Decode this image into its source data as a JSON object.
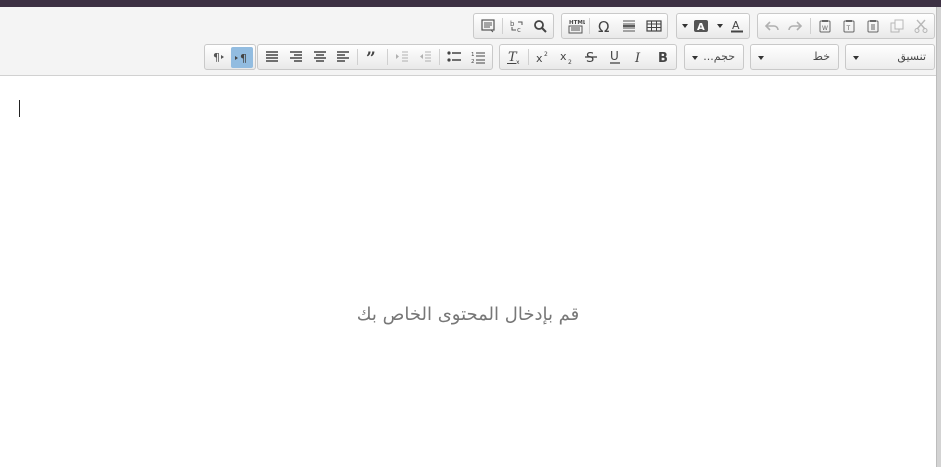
{
  "toolbar": {
    "styles_combo": "تنسيق",
    "font_combo": "خط",
    "size_combo": "حجم..."
  },
  "editor": {
    "placeholder": "قم بإدخال المحتوى الخاص بك"
  },
  "colors": {
    "accent_active": "#92bce0",
    "topbar": "#3d3143"
  }
}
